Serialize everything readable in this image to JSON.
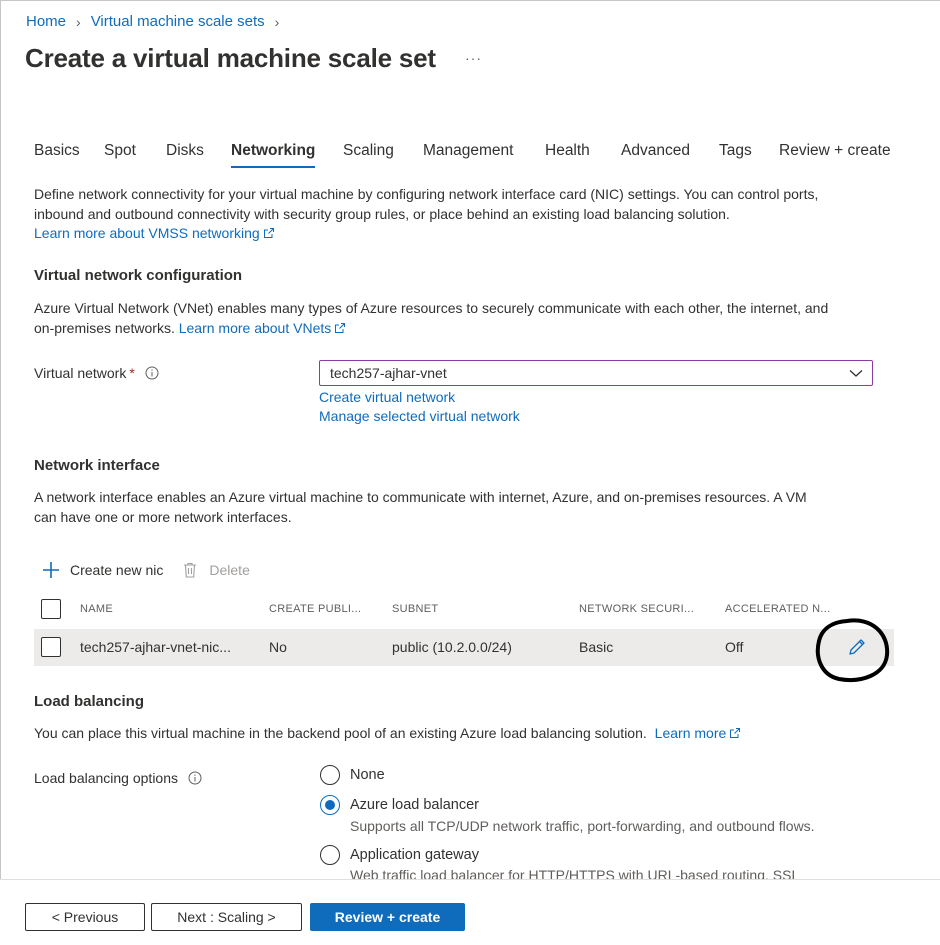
{
  "breadcrumb": {
    "home": "Home",
    "parent": "Virtual machine scale sets"
  },
  "page": {
    "title": "Create a virtual machine scale set",
    "more": "···"
  },
  "tabs": [
    "Basics",
    "Spot",
    "Disks",
    "Networking",
    "Scaling",
    "Management",
    "Health",
    "Advanced",
    "Tags",
    "Review + create"
  ],
  "active_tab": "Networking",
  "intro": {
    "line1": "Define network connectivity for your virtual machine by configuring network interface card (NIC) settings. You can control ports,",
    "line2": "inbound and outbound connectivity with security group rules, or place behind an existing load balancing solution.",
    "link": "Learn more about VMSS networking"
  },
  "vnet_section": {
    "heading": "Virtual network configuration",
    "line1": "Azure Virtual Network (VNet) enables many types of Azure resources to securely communicate with each other, the internet, and",
    "line2": "on-premises networks.",
    "link": "Learn more about VNets",
    "field_label": "Virtual network",
    "required_mark": "*",
    "selected_value": "tech257-ajhar-vnet",
    "create_link": "Create virtual network",
    "manage_link": "Manage selected virtual network"
  },
  "nic_section": {
    "heading": "Network interface",
    "line1": "A network interface enables an Azure virtual machine to communicate with internet, Azure, and on-premises resources. A VM",
    "line2": "can have one or more network interfaces.",
    "create_cmd": "Create new nic",
    "delete_cmd": "Delete",
    "columns": [
      "NAME",
      "CREATE PUBLI...",
      "SUBNET",
      "NETWORK SECURI...",
      "ACCELERATED N..."
    ],
    "rows": [
      {
        "name": "tech257-ajhar-vnet-nic...",
        "create_public": "No",
        "subnet": "public (10.2.0.0/24)",
        "nsg": "Basic",
        "accelerated": "Off"
      }
    ]
  },
  "lb_section": {
    "heading": "Load balancing",
    "desc": "You can place this virtual machine in the backend pool of an existing Azure load balancing solution.",
    "link": "Learn more",
    "field_label": "Load balancing options",
    "options": [
      {
        "label": "None",
        "desc": ""
      },
      {
        "label": "Azure load balancer",
        "desc": "Supports all TCP/UDP network traffic, port-forwarding, and outbound flows."
      },
      {
        "label": "Application gateway",
        "desc": "Web traffic load balancer for HTTP/HTTPS with URL-based routing, SSL"
      }
    ],
    "selected_option": "Azure load balancer"
  },
  "footer": {
    "previous": "< Previous",
    "next": "Next : Scaling >",
    "review": "Review + create"
  },
  "colors": {
    "accent": "#0f6cbd",
    "select_border": "#8a3ca8",
    "row_bg": "#edebe9",
    "annotation": "#000000"
  },
  "icons": {
    "external_link": "external-link-icon",
    "info": "info-icon",
    "add": "plus-icon",
    "delete": "trash-icon",
    "edit": "pencil-icon",
    "dropdown": "chevron-down-icon"
  }
}
